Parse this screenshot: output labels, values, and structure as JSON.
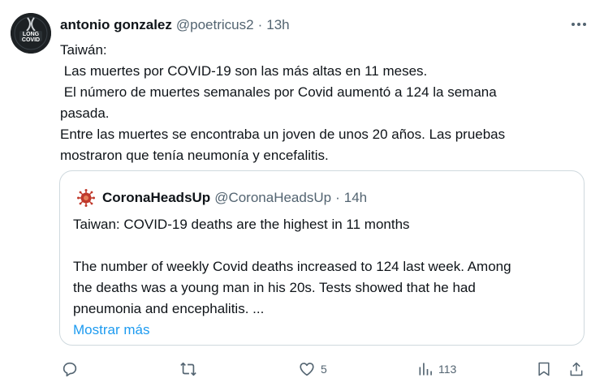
{
  "tweet": {
    "author_name": "antonio gonzalez",
    "author_handle": "@poetricus2",
    "separator": "·",
    "time": "13h",
    "avatar_text_top": "LONG",
    "avatar_text_bottom": "COVID",
    "text_lines": [
      "Taiwán:",
      " Las muertes por COVID-19 son las más altas en 11 meses.",
      " El número de muertes semanales por Covid aumentó a 124 la semana",
      "pasada.",
      "Entre las muertes se encontraba un joven de unos 20 años. Las pruebas",
      "mostraron que tenía neumonía y encefalitis."
    ]
  },
  "quote": {
    "author_name": "CoronaHeadsUp",
    "author_handle": "@CoronaHeadsUp",
    "separator": "·",
    "time": "14h",
    "line1": "Taiwan: COVID-19 deaths are the highest in 11 months",
    "line2": "The number of weekly Covid deaths increased to 124 last week. Among",
    "line3": "the deaths was a young man in his 20s. Tests showed that he had",
    "line4": "pneumonia and encephalitis. ...",
    "show_more": "Mostrar más"
  },
  "actions": {
    "likes": "5",
    "views": "113"
  },
  "colors": {
    "text": "#0f1419",
    "secondary": "#536471",
    "link": "#1d9bf0",
    "border": "#cfd9de"
  }
}
